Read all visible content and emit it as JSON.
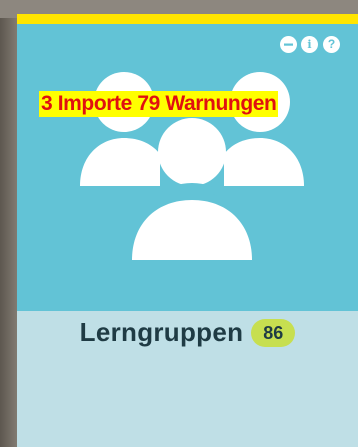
{
  "tile": {
    "controls": {
      "minus_icon": "minus-icon",
      "info_glyph": "i",
      "help_glyph": "?"
    },
    "icon": "users-group-icon",
    "warning_text": "3 Importe 79 Warnungen",
    "title": "Lerngruppen",
    "count": "86",
    "colors": {
      "accent_bar": "#ffe500",
      "tile_top": "#62c3d6",
      "tile_bottom": "#bfdfe6",
      "badge": "#c7df50",
      "warning_text": "#e01010",
      "warning_bg": "#ffff00"
    }
  }
}
